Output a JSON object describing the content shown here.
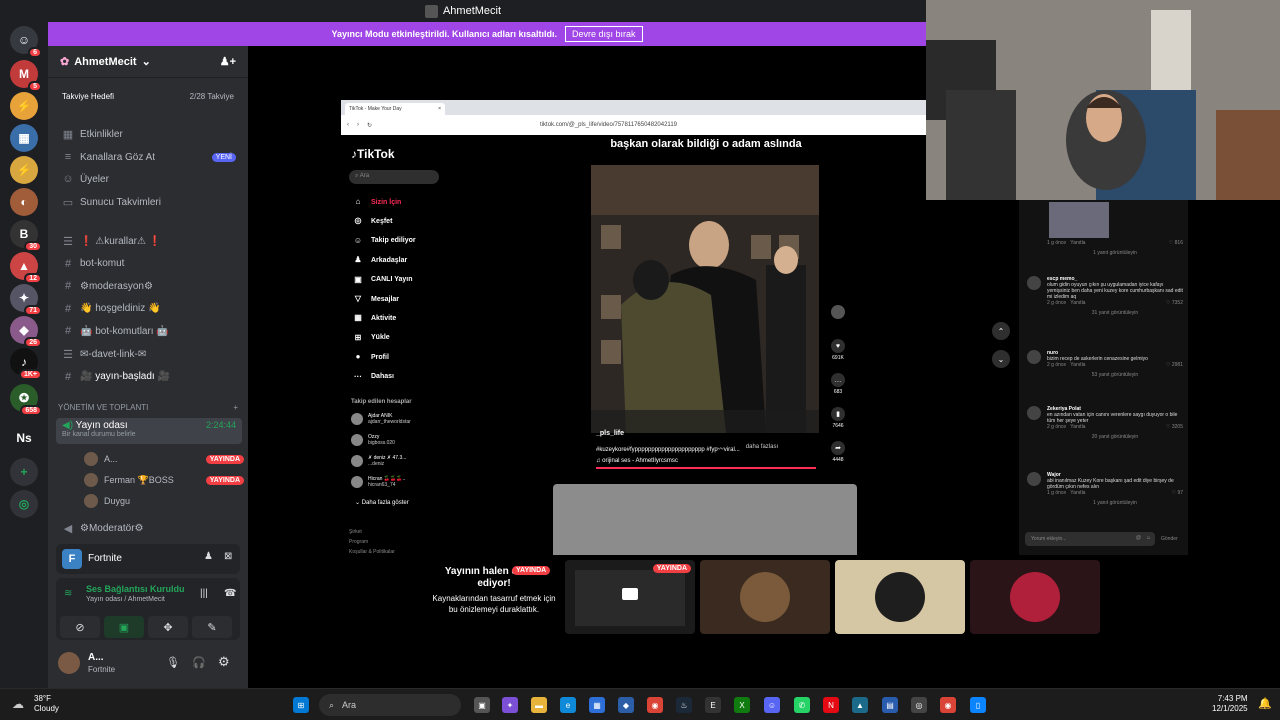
{
  "window": {
    "title": "AhmetMecit"
  },
  "banner": {
    "text": "Yayıncı Modu etkinleştirildi. Kullanıcı adları kısaltıldı.",
    "button": "Devre dışı bırak"
  },
  "rail": {
    "badges": [
      "6",
      "5",
      "30",
      "12",
      "71",
      "26",
      "1K+",
      "658"
    ],
    "ns_label": "Ns"
  },
  "server": {
    "name": "AhmetMecit",
    "boost_label": "Takviye Hedefi",
    "boost_count": "2/28 Takviye"
  },
  "menu": {
    "events": "Etkinlikler",
    "browse": "Kanallara Göz At",
    "new_tag": "YENİ",
    "members": "Üyeler",
    "guide": "Sunucu Takvimleri"
  },
  "channels": [
    {
      "icon": "☰",
      "label": "❗ ⚠kurallar⚠ ❗"
    },
    {
      "icon": "#",
      "label": "bot-komut"
    },
    {
      "icon": "#",
      "label": "⚙moderasyon⚙"
    },
    {
      "icon": "#",
      "label": "👋 hoşgeldiniz 👋"
    },
    {
      "icon": "#",
      "label": "🤖 bot-komutları 🤖"
    },
    {
      "icon": "☰",
      "label": "✉-davet-link-✉"
    },
    {
      "icon": "#",
      "label": "🎥 yayın-başladı 🎥"
    }
  ],
  "category": {
    "label": "YÖNETİM VE TOPLANTI",
    "add": "+"
  },
  "voice": {
    "name": "Yayın odası",
    "time": "2:24:44",
    "status": "Bir kanal durumu belirle"
  },
  "voice_users": [
    {
      "name": "A...",
      "live": "YAYINDA"
    },
    {
      "name": "Ferman 🏆BOSS",
      "live": "YAYINDA"
    },
    {
      "name": "Duygu",
      "live": ""
    }
  ],
  "moderator_channel": "⚙Moderatör⚙",
  "activity": {
    "name": "Fortnite"
  },
  "connection": {
    "title": "Ses Bağlantısı Kuruldu",
    "subtitle": "Yayın odası / AhmetMecit"
  },
  "user": {
    "name": "A...",
    "status": "Fortnite"
  },
  "browser": {
    "tab": "TikTok - Make Your Day",
    "url": "tiktok.com/@_pls_life/video/7578117650482042119"
  },
  "tiktok": {
    "logo": "TikTok",
    "search_placeholder": "Ara",
    "nav": [
      {
        "icon": "⌂",
        "label": "Sizin İçin"
      },
      {
        "icon": "◎",
        "label": "Keşfet"
      },
      {
        "icon": "☺",
        "label": "Takip ediliyor"
      },
      {
        "icon": "♟",
        "label": "Arkadaşlar"
      },
      {
        "icon": "▣",
        "label": "CANLI Yayın"
      },
      {
        "icon": "▽",
        "label": "Mesajlar"
      },
      {
        "icon": "▦",
        "label": "Aktivite"
      },
      {
        "icon": "⊞",
        "label": "Yükle"
      },
      {
        "icon": "●",
        "label": "Profil"
      },
      {
        "icon": "···",
        "label": "Dahası"
      }
    ],
    "following_header": "Takip edilen hesaplar",
    "accounts": [
      {
        "name": "Ajdar ANIK",
        "handle": "ajdarr_theworldstar"
      },
      {
        "name": "Ozzy",
        "handle": "bigboss.020"
      },
      {
        "name": "✗ deniz ✗ 47.3...",
        "handle": "...deniz"
      },
      {
        "name": "Hicran 🍒🍒🍒..",
        "handle": "hicran63_74"
      }
    ],
    "see_more": "Daha fazla göster",
    "footer": [
      "Şirket",
      "Program",
      "Koşullar & Politikalar"
    ],
    "video_title": "başkan olarak bildiği o adam aslında",
    "author": "_pls_life",
    "caption": "#kuzeykore#fyppppppppppppppppppppp #fyp〰viral...",
    "caption_more": "daha fazlası",
    "sound": "♫ orijinal ses - AhmetIlyrcsmsc",
    "counts": {
      "likes": "691K",
      "comments": "683",
      "saves": "7646",
      "shares": "4448"
    }
  },
  "comments": [
    {
      "name": "",
      "text": "",
      "time": "1 g önce",
      "reply": "Yanıtla",
      "likes": "816",
      "more": "1 yanıt görüntüleyin"
    },
    {
      "name": "escp memo_",
      "text": "olum gidin oyuyun çıkın şu uygulamadan iyice kafayı yemişsiniz ben daha yeni kuzey kore cumhurbaşkanı sad edit mi izledim aq",
      "time": "2 g önce",
      "reply": "Yanıtla",
      "likes": "7352",
      "more": "31 yanıt görüntüleyin"
    },
    {
      "name": "nuro",
      "text": "bizim recep de askerlerin cenazesine gelmiyo",
      "time": "2 g önce",
      "reply": "Yanıtla",
      "likes": "2981",
      "more": "53 yanıt görüntüleyin"
    },
    {
      "name": "Zekeriya Polat",
      "text": "en azından vatan için canını verenlere saygı duyuyor o bile tüm her şeye yeter",
      "time": "2 g önce",
      "reply": "Yanıtla",
      "likes": "3205",
      "more": "20 yanıt görüntüleyin"
    },
    {
      "name": "Wajor",
      "text": "abi inanılmaz Kuzey Kore başkanı şad edit diye birşey de gördüm çıkın nefes alın",
      "time": "1 g önce",
      "reply": "Yanıtla",
      "likes": "97",
      "more": "1 yanıt görüntüleyin"
    }
  ],
  "comment_input": {
    "placeholder": "Yorum ekleyin...",
    "send": "Gönder"
  },
  "stream": {
    "pause_title": "Yayının halen devam ediyor!",
    "pause_text": "Kaynaklarından tasarruf etmek için bu önizlemeyi duraklattık.",
    "live": "YAYINDA"
  },
  "taskbar": {
    "weather_temp": "38°F",
    "weather_desc": "Cloudy",
    "search": "Ara",
    "time": "7:43 PM",
    "date": "12/1/2025"
  }
}
